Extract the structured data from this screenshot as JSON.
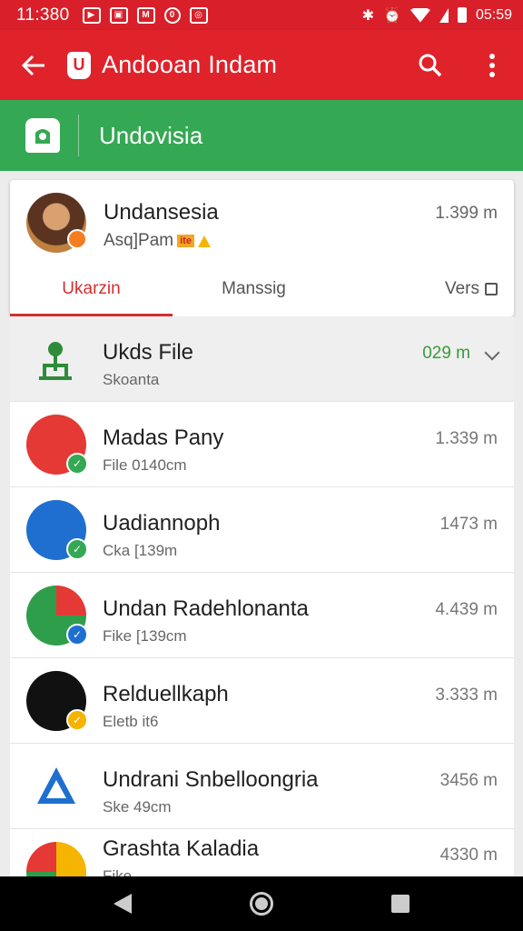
{
  "status_bar": {
    "time": "11:380",
    "clock_right": "05:59",
    "notification_icons": [
      "app-icon",
      "app-icon",
      "app-icon",
      "app-icon",
      "app-icon"
    ]
  },
  "app_bar": {
    "title": "Andooan Indam",
    "logo_letter": "U"
  },
  "section_bar": {
    "title": "Undovisia"
  },
  "card": {
    "name": "Undansesia",
    "subtitle": "Asq]Pam",
    "tag": "ite",
    "size": "1.399 m",
    "tabs": [
      "Ukarzin",
      "Manssig",
      "Vers"
    ]
  },
  "header_row": {
    "name": "Ukds File",
    "sub": "Skoanta",
    "size": "029 m"
  },
  "rows": [
    {
      "name": "Madas Pany",
      "sub": "File 0140cm",
      "size": "1.339 m",
      "icon_color": "#e53935",
      "badge_color": "#34a853"
    },
    {
      "name": "Uadiannoph",
      "sub": "Cka [139m",
      "size": "1473 m",
      "icon_color": "#1e6fd0",
      "badge_color": "#34a853"
    },
    {
      "name": "Undan Radehlonanta",
      "sub": "Fike [139cm",
      "size": "4.439 m",
      "icon_color": "#2e9e4a",
      "badge_color": "#1e6fd0"
    },
    {
      "name": "Relduellkaph",
      "sub": "Eletb it6",
      "size": "3.333 m",
      "icon_color": "#111111",
      "badge_color": "#f5b400"
    },
    {
      "name": "Undrani Snbelloongria",
      "sub": "Ske 49cm",
      "size": "3456 m",
      "icon_color": "#ffffff",
      "badge_color": ""
    },
    {
      "name": "Grashta Kaladia",
      "sub": "Fike",
      "size": "4330 m",
      "icon_color": "#f5b400",
      "badge_color": "#e53935"
    }
  ]
}
